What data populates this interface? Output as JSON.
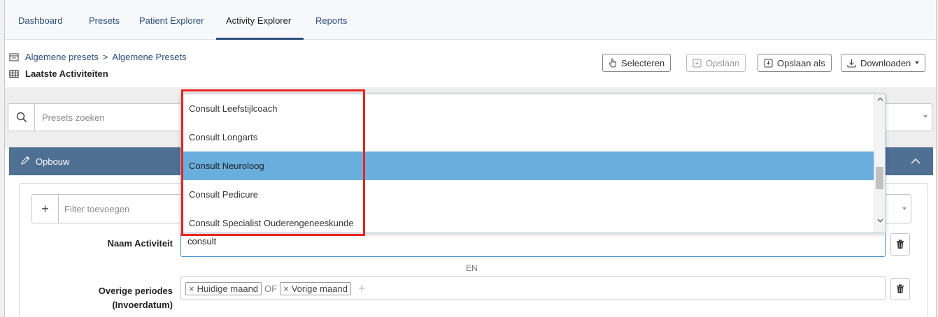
{
  "nav": {
    "tabs": [
      {
        "label": "Dashboard"
      },
      {
        "label": "Presets"
      },
      {
        "label": "Patient Explorer"
      },
      {
        "label": "Activity Explorer"
      },
      {
        "label": "Reports"
      }
    ],
    "active": "Activity Explorer"
  },
  "header": {
    "breadcrumb": [
      "Algemene presets",
      "Algemene Presets"
    ],
    "breadcrumb_separator": ">",
    "title": "Laatste Activiteiten",
    "buttons": {
      "select": "Selecteren",
      "save": "Opslaan",
      "save_as": "Opslaan als",
      "download": "Downloaden"
    }
  },
  "search": {
    "placeholder": "Presets zoeken"
  },
  "opbouw": {
    "label": "Opbouw"
  },
  "filter": {
    "placeholder": "Filter toevoegen"
  },
  "rows": {
    "naam_label": "Naam Activiteit",
    "naam_value": "consult",
    "conjunction": "EN",
    "periodes_label_line1": "Overige periodes",
    "periodes_label_line2": "(Invoerdatum)",
    "periodes_tags": [
      "Huidige maand",
      "Vorige maand"
    ],
    "periodes_joiner": "OF"
  },
  "dropdown": {
    "items": [
      "Consult Leefstijlcoach",
      "Consult Longarts",
      "Consult Neuroloog",
      "Consult Pedicure",
      "Consult Specialist Ouderengeneeskunde"
    ],
    "selected_index": 2,
    "scroll_position": 0.55
  },
  "colors": {
    "nav_accent": "#2c4f7c",
    "opbouw_bar": "#4f6f93",
    "selected_item": "#6aaede",
    "highlight_box": "#e8241f"
  }
}
